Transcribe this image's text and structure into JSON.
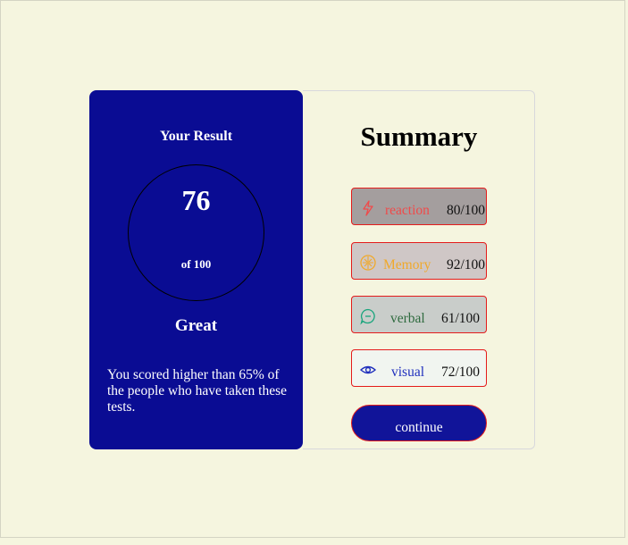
{
  "result": {
    "title": "Your Result",
    "score": "76",
    "out_of": "of 100",
    "grade": "Great",
    "description": "You scored higher than 65% of the people who have taken these tests."
  },
  "summary": {
    "title": "Summary",
    "items": [
      {
        "label": "reaction",
        "value": "80/100",
        "icon": "lightning-icon",
        "color": "#f04a4a",
        "bg": "#a49e9e"
      },
      {
        "label": "Memory",
        "value": "92/100",
        "icon": "brain-icon",
        "color": "#f0a92a",
        "bg": "#cfc7c6"
      },
      {
        "label": "verbal",
        "value": "61/100",
        "icon": "chat-bubble-icon",
        "color": "#2f6b3f",
        "bg": "#c9cdca"
      },
      {
        "label": "visual",
        "value": "72/100",
        "icon": "eye-icon",
        "color": "#1f2fbd",
        "bg": "#f1f5f0"
      }
    ]
  },
  "continue_label": "continue",
  "colors": {
    "background": "#f5f5df",
    "result_panel": "#0a0c93",
    "button": "#111499",
    "border_accent": "#e41b1b"
  }
}
